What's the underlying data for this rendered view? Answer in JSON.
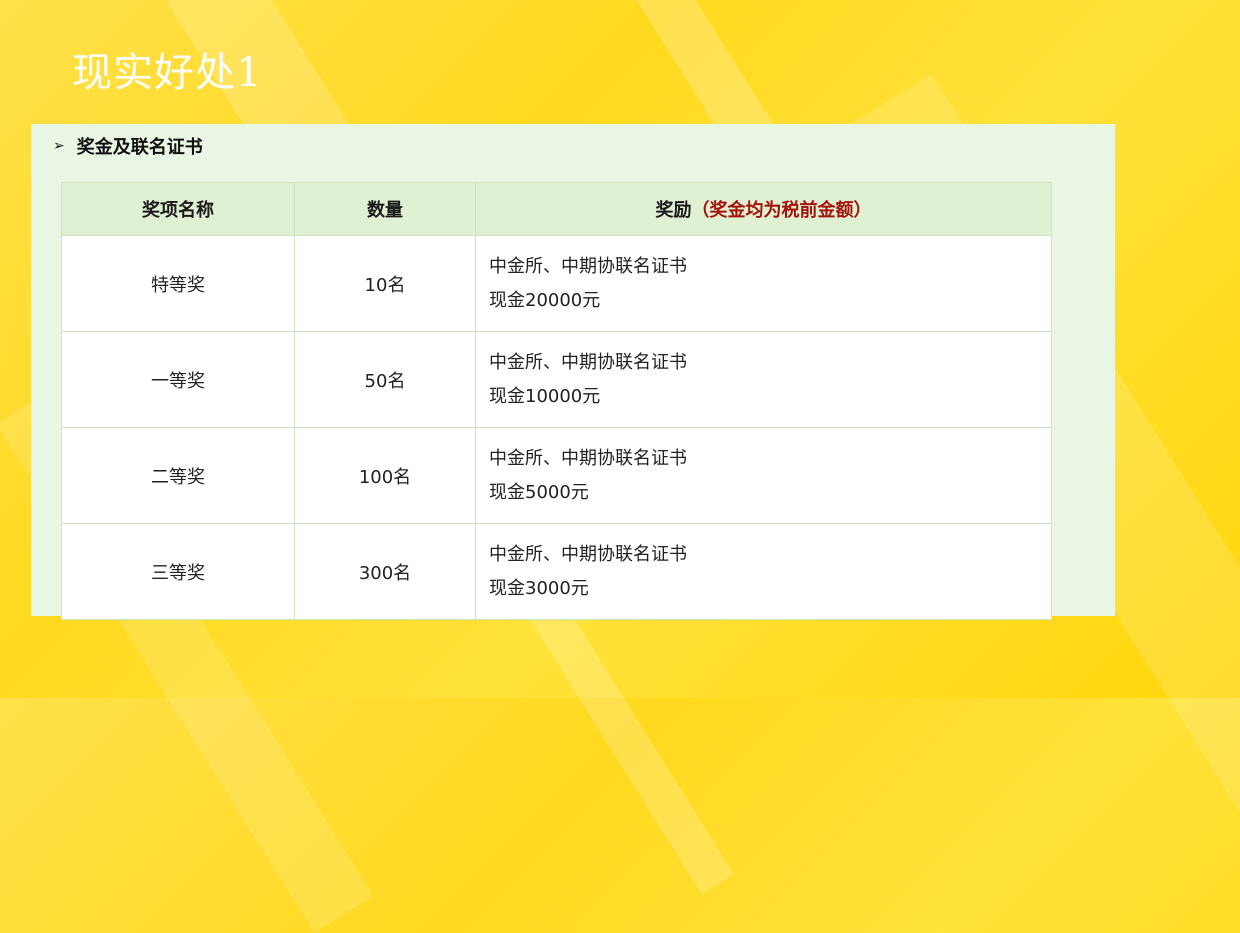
{
  "slide": {
    "title": "现实好处1",
    "section_label": "奖金及联名证书"
  },
  "table": {
    "headers": {
      "name": "奖项名称",
      "count": "数量",
      "reward": "奖励",
      "reward_note": "（奖金均为税前金额）"
    },
    "rows": [
      {
        "name": "特等奖",
        "count": "10名",
        "cert": "中金所、中期协联名证书",
        "cash": "现金20000元"
      },
      {
        "name": "一等奖",
        "count": "50名",
        "cert": "中金所、中期协联名证书",
        "cash": "现金10000元"
      },
      {
        "name": "二等奖",
        "count": "100名",
        "cert": "中金所、中期协联名证书",
        "cash": "现金5000元"
      },
      {
        "name": "三等奖",
        "count": "300名",
        "cert": "中金所、中期协联名证书",
        "cash": "现金3000元"
      }
    ]
  },
  "colors": {
    "background": "#ffd91f",
    "panel": "#eaf6e4",
    "header_row": "#dff0d3",
    "note": "#a3130c"
  },
  "icons": {
    "bullet": "arrow-right-icon"
  }
}
